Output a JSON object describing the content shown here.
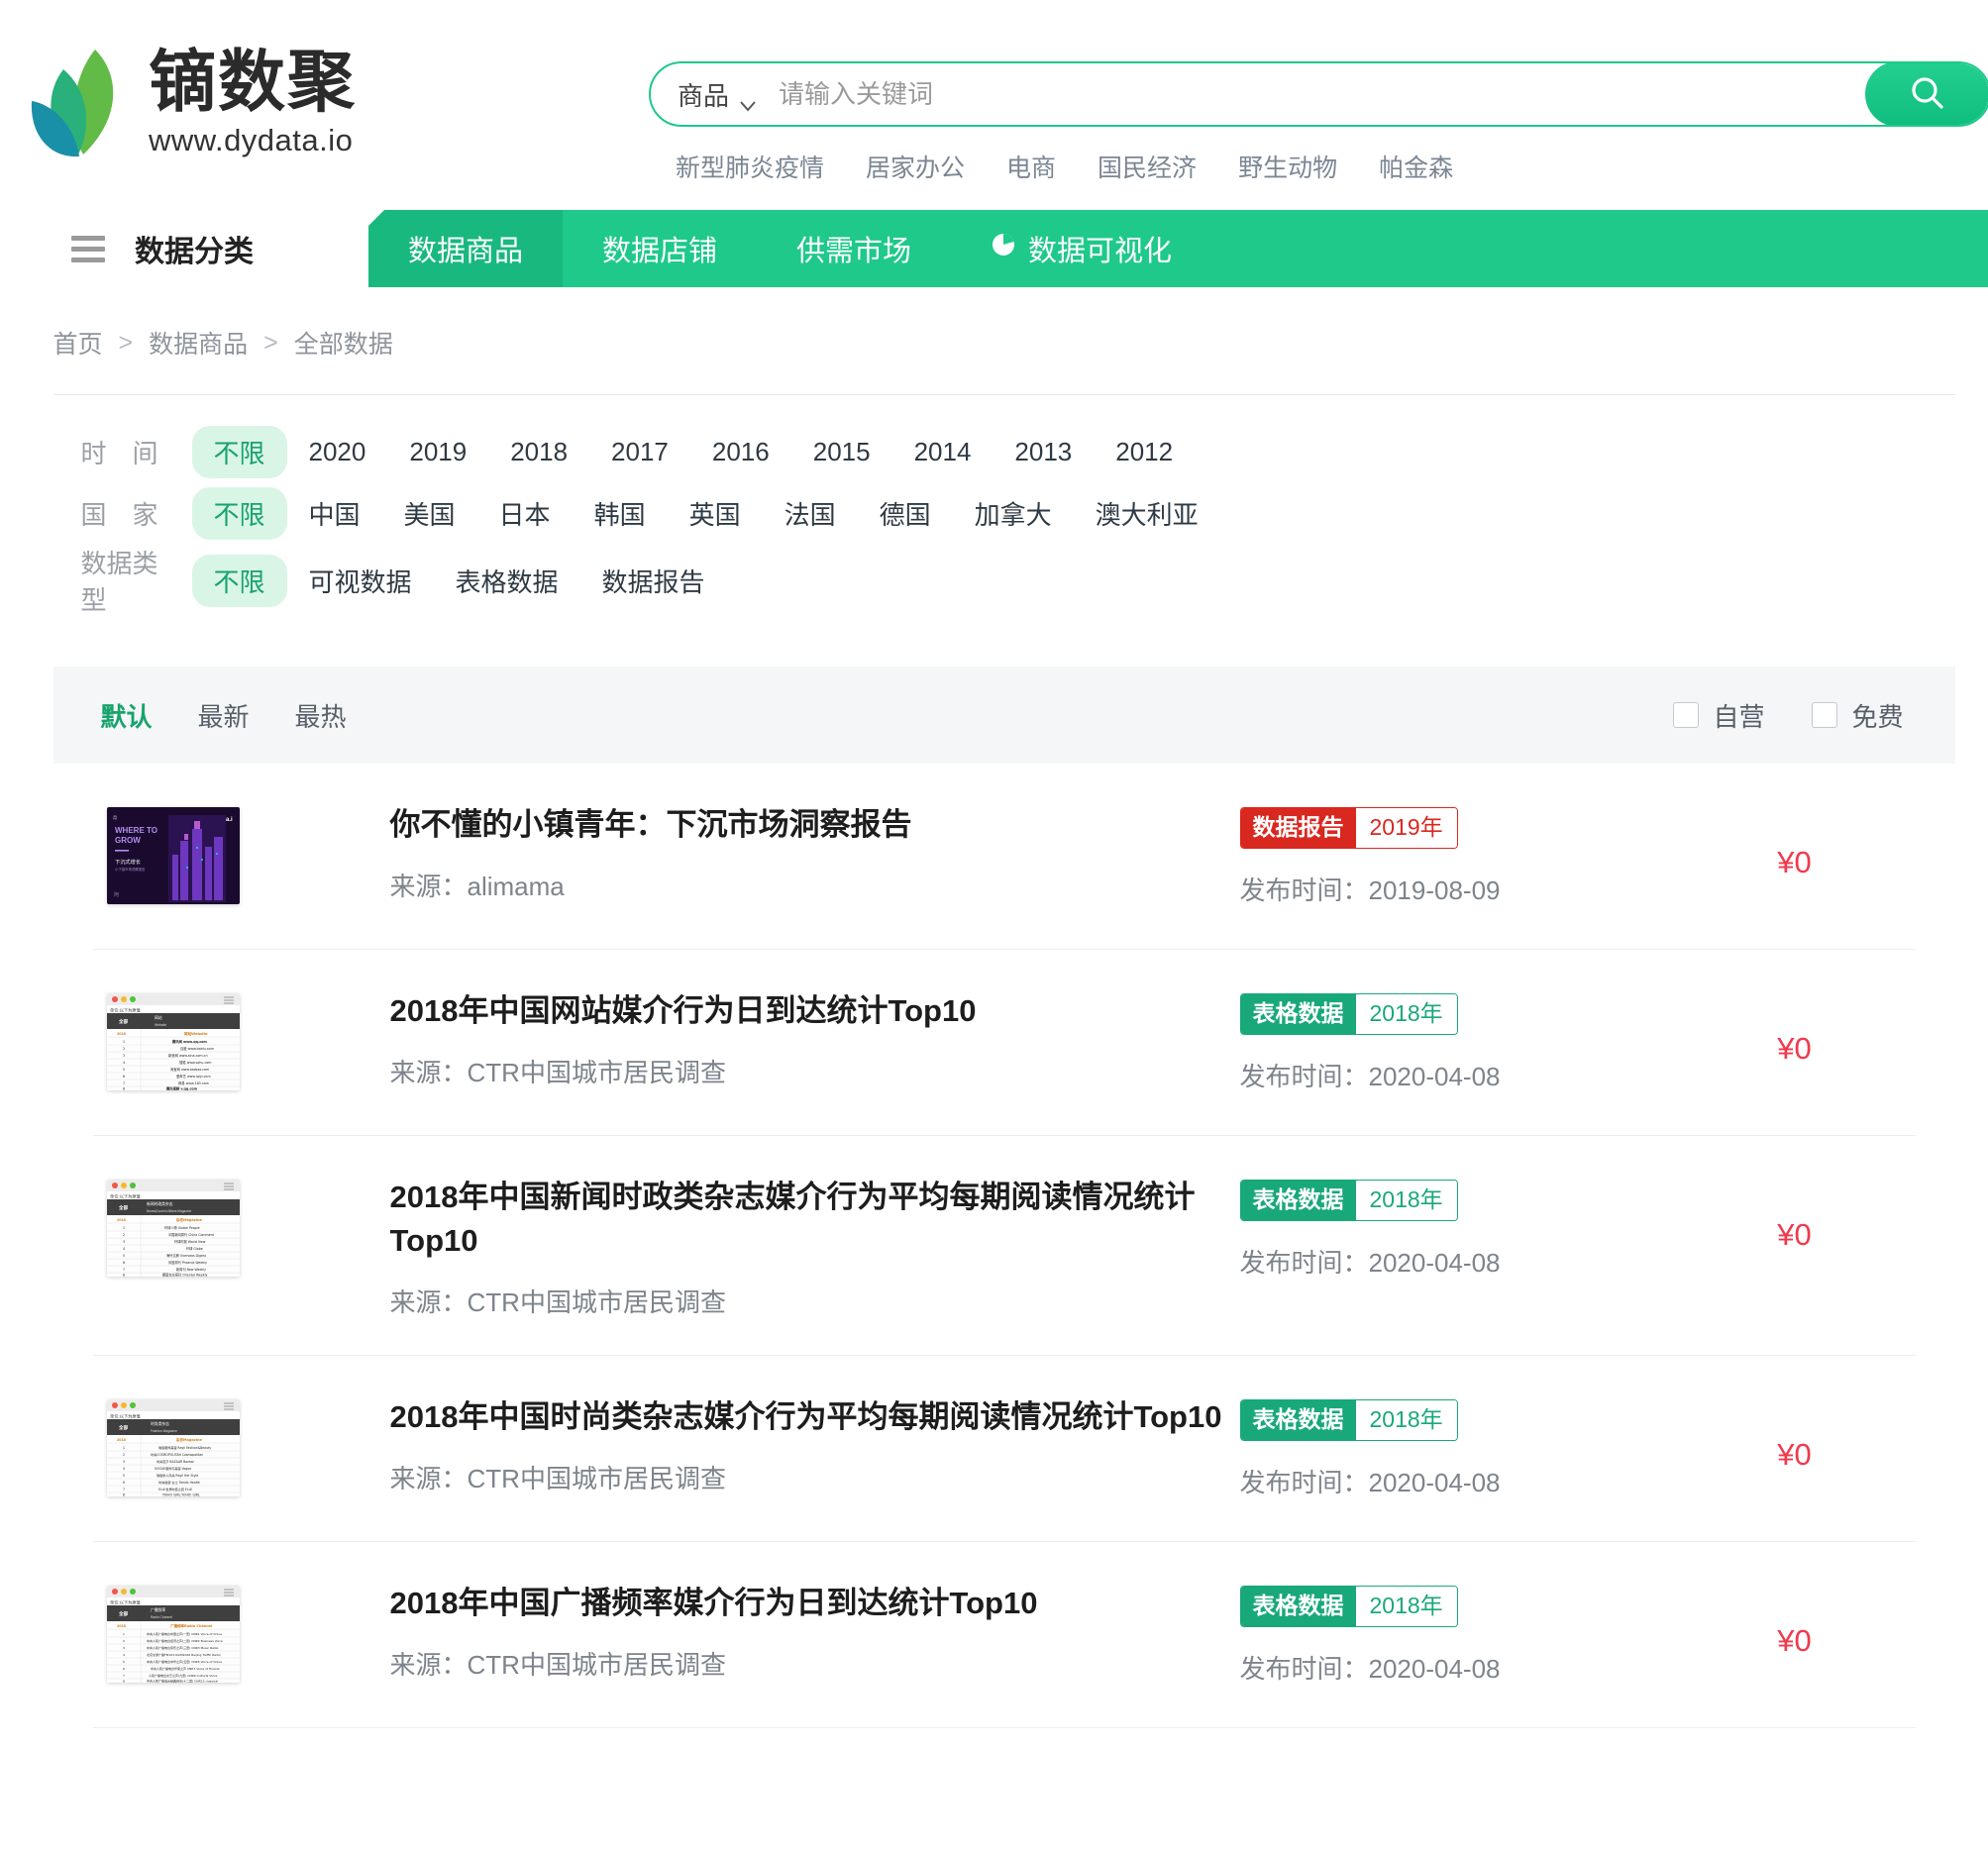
{
  "brand": {
    "name_cn": "镝数聚",
    "url": "www.dydata.io",
    "logo_icon": "leaf-logo-icon",
    "accent": "#1ec98a"
  },
  "search": {
    "category": "商品",
    "category_icon": "chevron-down-icon",
    "placeholder": "请输入关键词",
    "value": "",
    "button_icon": "search-icon",
    "hot_words": [
      "新型肺炎疫情",
      "居家办公",
      "电商",
      "国民经济",
      "野生动物",
      "帕金森"
    ]
  },
  "nav": {
    "category_button": {
      "label": "数据分类",
      "icon": "hamburger-icon"
    },
    "items": [
      {
        "label": "数据商品",
        "active": true,
        "icon": ""
      },
      {
        "label": "数据店铺",
        "active": false,
        "icon": ""
      },
      {
        "label": "供需市场",
        "active": false,
        "icon": ""
      },
      {
        "label": "数据可视化",
        "active": false,
        "icon": "pie-chart-icon"
      }
    ]
  },
  "breadcrumb": {
    "items": [
      "首页",
      "数据商品",
      "全部数据"
    ],
    "separator": ">"
  },
  "filters": [
    {
      "label": "时　间",
      "options": [
        "不限",
        "2020",
        "2019",
        "2018",
        "2017",
        "2016",
        "2015",
        "2014",
        "2013",
        "2012"
      ],
      "selected": "不限"
    },
    {
      "label": "国　家",
      "options": [
        "不限",
        "中国",
        "美国",
        "日本",
        "韩国",
        "英国",
        "法国",
        "德国",
        "加拿大",
        "澳大利亚"
      ],
      "selected": "不限"
    },
    {
      "label": "数据类型",
      "options": [
        "不限",
        "可视数据",
        "表格数据",
        "数据报告"
      ],
      "selected": "不限"
    }
  ],
  "sortbar": {
    "options": [
      "默认",
      "最新",
      "最热"
    ],
    "selected": "默认",
    "checkboxes": [
      {
        "label": "自营",
        "checked": false
      },
      {
        "label": "免费",
        "checked": false
      }
    ]
  },
  "results": [
    {
      "title": "你不懂的小镇青年：下沉市场洞察报告",
      "source_label": "来源：",
      "source": "alimama",
      "tag_kind": "数据报告",
      "tag_year": "2019年",
      "tag_color": "red",
      "date_label": "发布时间：",
      "date": "2019-08-09",
      "price": "¥0",
      "thumb": "report-cover-where-to-grow"
    },
    {
      "title": "2018年中国网站媒介行为日到达统计Top10",
      "source_label": "来源：",
      "source": "CTR中国城市居民调查",
      "tag_kind": "表格数据",
      "tag_year": "2018年",
      "tag_color": "green",
      "date_label": "发布时间：",
      "date": "2020-04-08",
      "price": "¥0",
      "thumb": "spreadsheet-website"
    },
    {
      "title": "2018年中国新闻时政类杂志媒介行为平均每期阅读情况统计Top10",
      "source_label": "来源：",
      "source": "CTR中国城市居民调查",
      "tag_kind": "表格数据",
      "tag_year": "2018年",
      "tag_color": "green",
      "date_label": "发布时间：",
      "date": "2020-04-08",
      "price": "¥0",
      "thumb": "spreadsheet-news-magazine"
    },
    {
      "title": "2018年中国时尚类杂志媒介行为平均每期阅读情况统计Top10",
      "source_label": "来源：",
      "source": "CTR中国城市居民调查",
      "tag_kind": "表格数据",
      "tag_year": "2018年",
      "tag_color": "green",
      "date_label": "发布时间：",
      "date": "2020-04-08",
      "price": "¥0",
      "thumb": "spreadsheet-fashion-magazine"
    },
    {
      "title": "2018年中国广播频率媒介行为日到达统计Top10",
      "source_label": "来源：",
      "source": "CTR中国城市居民调查",
      "tag_kind": "表格数据",
      "tag_year": "2018年",
      "tag_color": "green",
      "date_label": "发布时间：",
      "date": "2020-04-08",
      "price": "¥0",
      "thumb": "spreadsheet-radio-channel"
    }
  ]
}
